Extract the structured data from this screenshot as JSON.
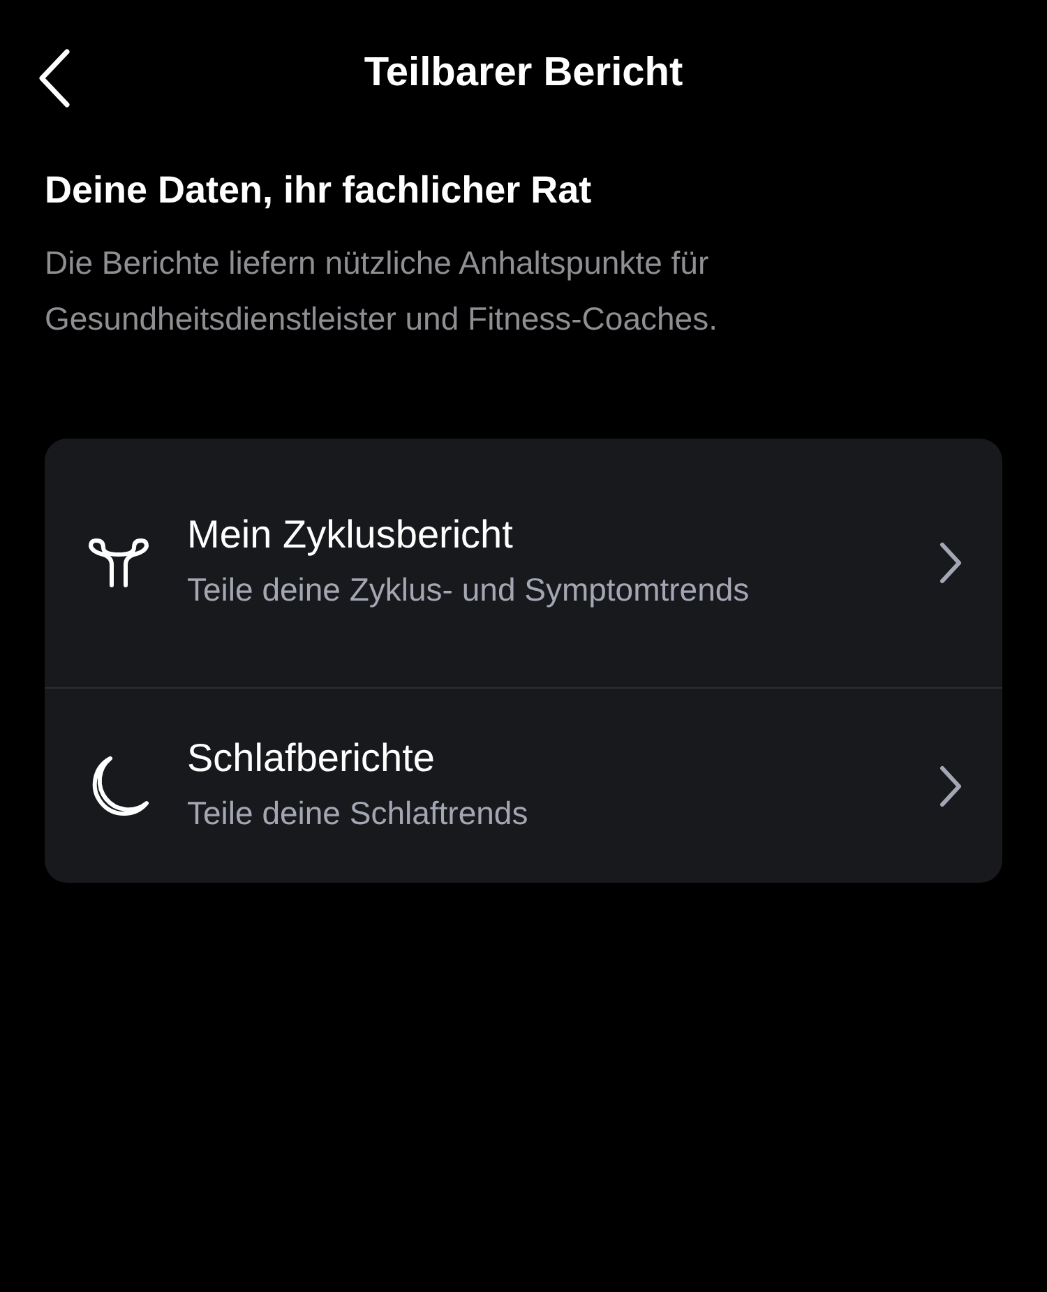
{
  "header": {
    "title": "Teilbarer Bericht"
  },
  "intro": {
    "heading": "Deine Daten, ihr fachlicher Rat",
    "text": "Die Berichte liefern nützliche Anhaltspunkte für Gesundheitsdienstleister und Fitness-Coaches."
  },
  "reports": [
    {
      "kind": "cycle",
      "title": "Mein Zyklusbericht",
      "subtitle": "Teile deine Zyklus- und Symptomtrends"
    },
    {
      "kind": "sleep",
      "title": "Schlafberichte",
      "subtitle": "Teile deine Schlaftrends"
    }
  ]
}
